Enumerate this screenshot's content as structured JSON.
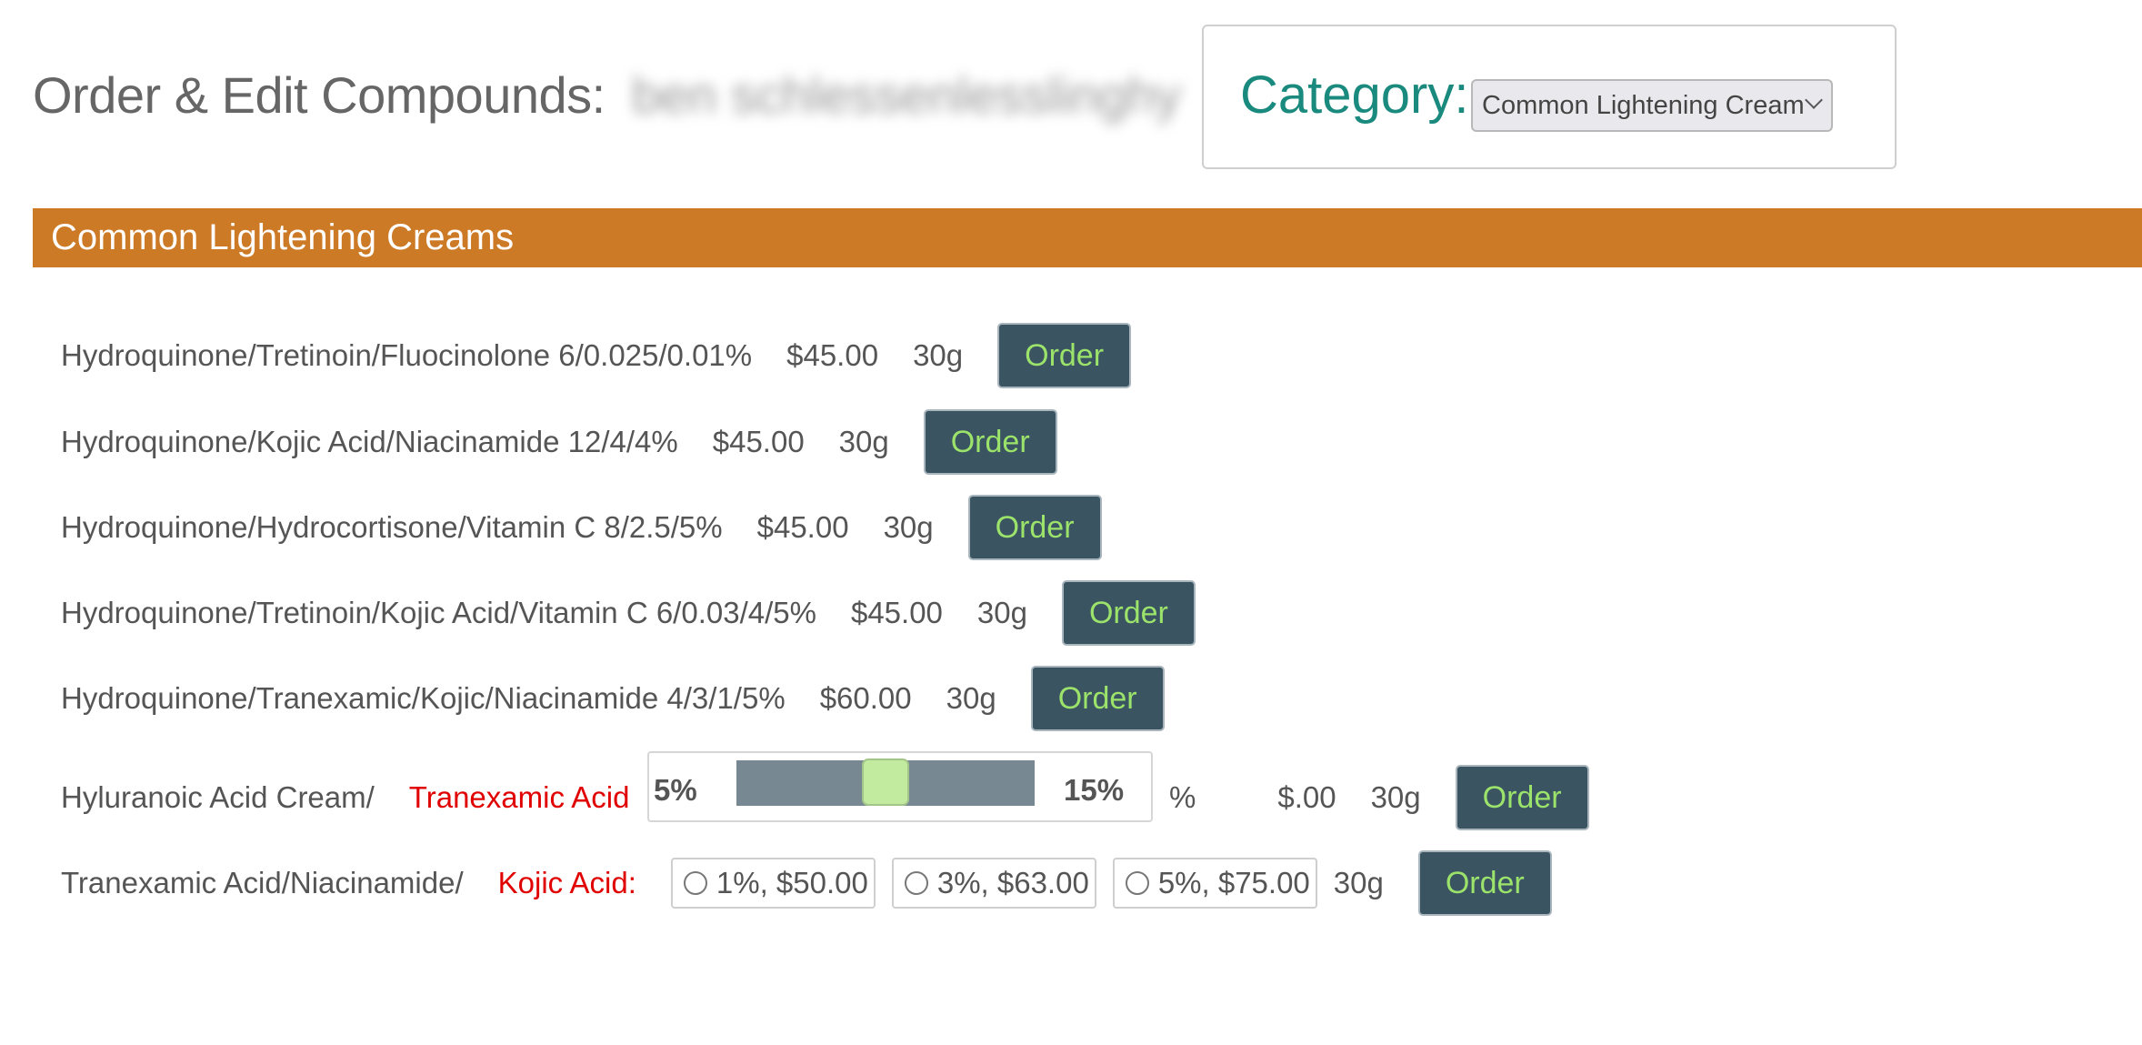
{
  "header": {
    "title": "Order & Edit Compounds:",
    "patient_name": "ben schlessenlesslinghy",
    "category_label": "Category:",
    "category_selected": "Common Lightening Cream"
  },
  "section": {
    "title": "Common Lightening Creams"
  },
  "products": [
    {
      "name": "Hydroquinone/Tretinoin/Fluocinolone 6/0.025/0.01%",
      "price": "$45.00",
      "size": "30g",
      "button": "Order"
    },
    {
      "name": "Hydroquinone/Kojic Acid/Niacinamide 12/4/4%",
      "price": "$45.00",
      "size": "30g",
      "button": "Order"
    },
    {
      "name": "Hydroquinone/Hydrocortisone/Vitamin C 8/2.5/5%",
      "price": "$45.00",
      "size": "30g",
      "button": "Order"
    },
    {
      "name": "Hydroquinone/Tretinoin/Kojic Acid/Vitamin C 6/0.03/4/5%",
      "price": "$45.00",
      "size": "30g",
      "button": "Order"
    },
    {
      "name": "Hydroquinone/Tranexamic/Kojic/Niacinamide 4/3/1/5%",
      "price": "$60.00",
      "size": "30g",
      "button": "Order"
    }
  ],
  "slider_product": {
    "name": "Hyluranoic Acid Cream/",
    "ingredient": "Tranexamic Acid",
    "min_label": "5%",
    "max_label": "15%",
    "value_fraction": 0.5,
    "value_text": "",
    "unit": "%",
    "price": "$.00",
    "size": "30g",
    "button": "Order"
  },
  "radio_product": {
    "name": "Tranexamic Acid/Niacinamide/",
    "ingredient": "Kojic Acid:",
    "options": [
      "1%, $50.00",
      "3%, $63.00",
      "5%, $75.00"
    ],
    "size": "30g",
    "button": "Order"
  },
  "colors": {
    "accent_orange": "#cd7a27",
    "category_teal": "#1a8a7e",
    "button_bg": "#3b5462",
    "button_text": "#9be36a",
    "highlight_red": "#e00000"
  }
}
